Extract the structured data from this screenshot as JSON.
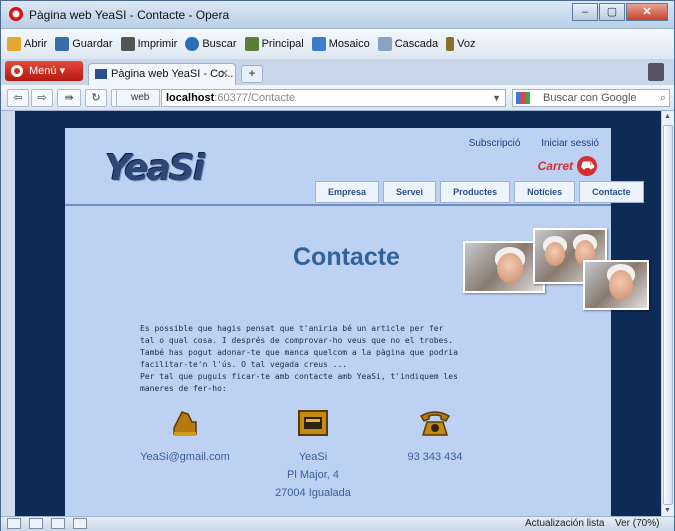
{
  "window": {
    "title": "Pàgina web YeaSI - Contacte - Opera",
    "controls": [
      "–",
      "▢",
      "✕"
    ]
  },
  "toolbar": {
    "items": [
      {
        "label": "Abrir",
        "icon": "folder-icon",
        "color": "#e6a72c"
      },
      {
        "label": "Guardar",
        "icon": "save-icon",
        "color": "#3a6ea8"
      },
      {
        "label": "Imprimir",
        "icon": "printer-icon",
        "color": "#555555"
      },
      {
        "label": "Buscar",
        "icon": "search-icon",
        "color": "#2a6bb5"
      },
      {
        "label": "Principal",
        "icon": "home-icon",
        "color": "#5a7e3a"
      },
      {
        "label": "Mosaico",
        "icon": "tile-icon",
        "color": "#3d7cc9"
      },
      {
        "label": "Cascada",
        "icon": "cascade-icon",
        "color": "#8aa3c3"
      },
      {
        "label": "Voz",
        "icon": "microphone-icon",
        "color": "#8a6e2a"
      }
    ]
  },
  "tabs": {
    "menu_label": "Menú",
    "active_tab": "Pàgina web YeaSI - Co...",
    "close": "✕",
    "new_tab": "+"
  },
  "nav": {
    "web_label": "web",
    "address_host": "localhost",
    "address_rest": ":60377/Contacte",
    "search_placeholder": "Buscar con Google",
    "back": "⇦",
    "forward": "⇨",
    "fastforward": "⇛",
    "reload": "↻",
    "home": "⌂"
  },
  "site": {
    "logo": "YeaSi",
    "links": [
      "Subscripció",
      "Iniciar sessió"
    ],
    "cart": "Carret",
    "menu": [
      "Empresa",
      "Servei",
      "Productes",
      "Notícies",
      "Contacte"
    ],
    "title": "Contacte",
    "paragraphs": [
      "Es possible que hagis pensat que t'aniria bé un article per fer tal o qual cosa. I després de comprovar-ho veus que no el trobes.",
      "També has pogut adonar-te que manca quelcom a la pàgina que podria facilitar-te'n l'ús. O tal vegada creus ...",
      "Per tal que puguis ficar-te amb contacte amb YeaSi, t'indiquem les maneres de fer-ho:"
    ],
    "contacts": [
      {
        "icon": "email-icon",
        "lines": [
          "YeaSi@gmail.com"
        ]
      },
      {
        "icon": "mailbox-icon",
        "lines": [
          "YeaSi",
          "Pl Major, 4",
          "27004 Igualada"
        ]
      },
      {
        "icon": "telephone-icon",
        "lines": [
          "93 343 434"
        ]
      }
    ]
  },
  "status": {
    "update": "Actualización lista",
    "zoom": "Ver (70%)"
  }
}
